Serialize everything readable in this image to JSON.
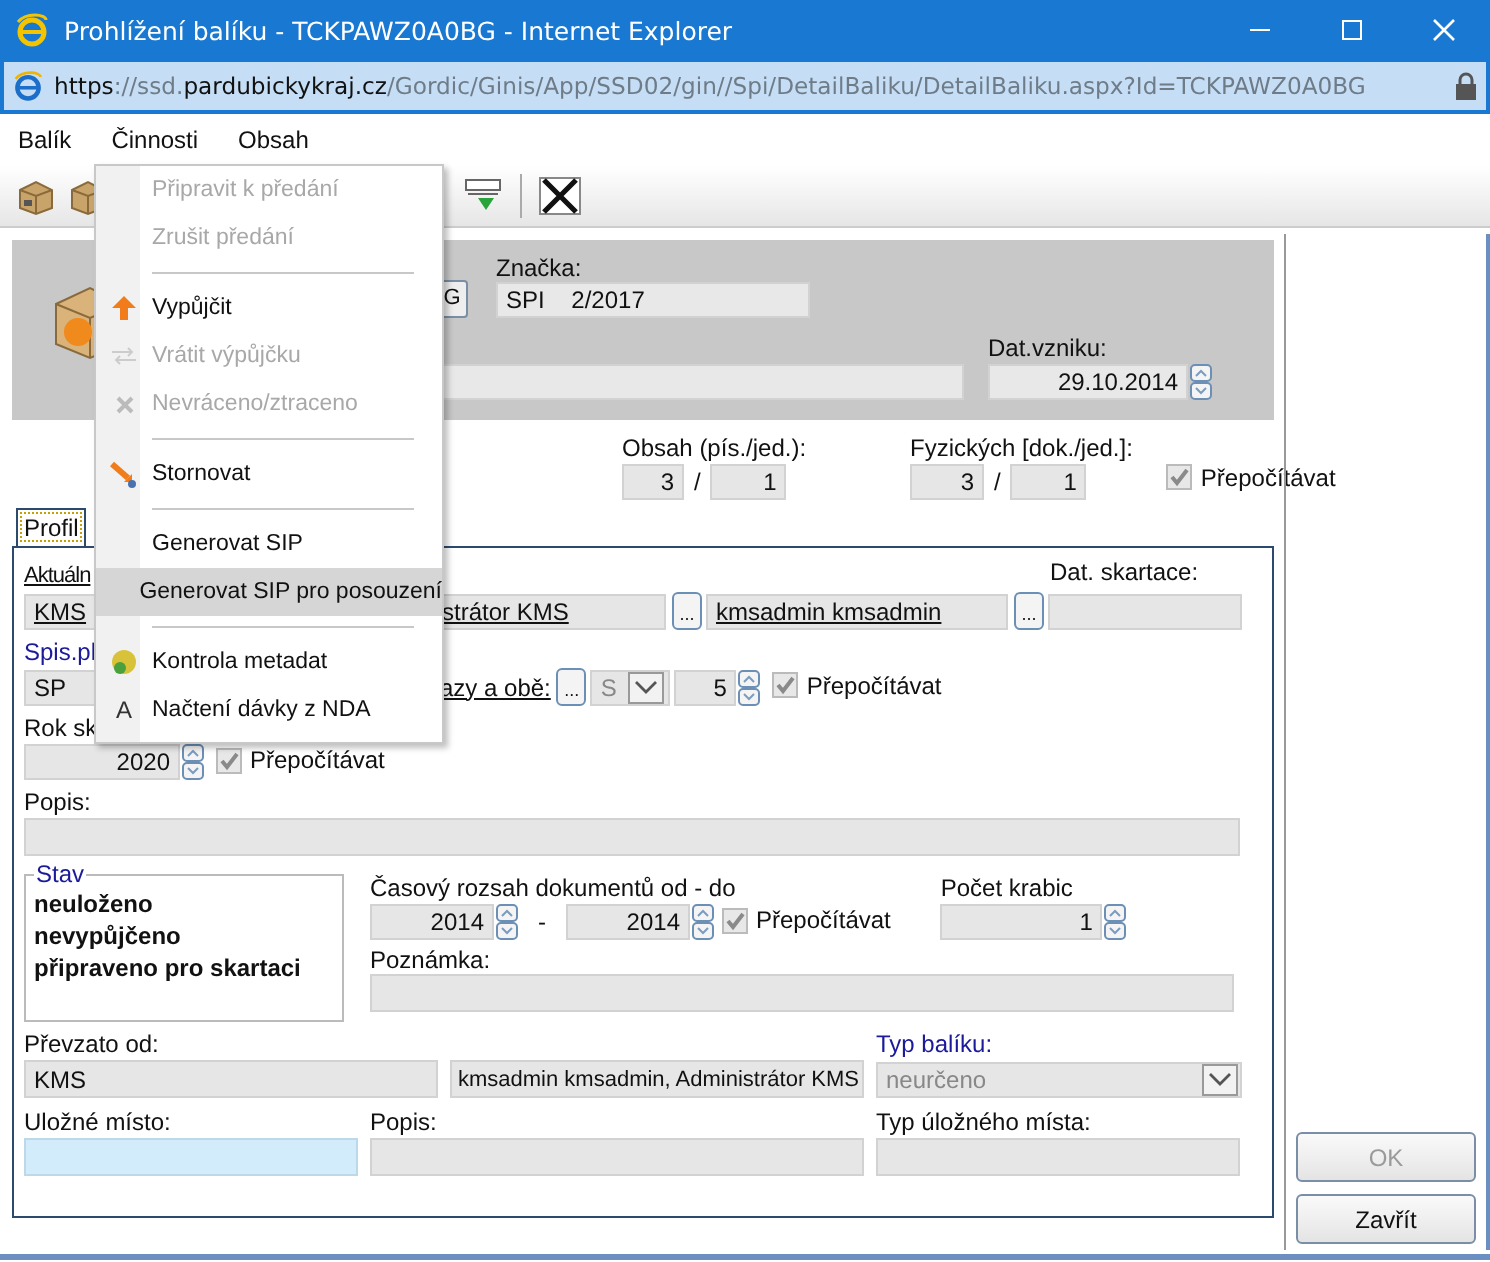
{
  "window": {
    "title": "Prohlížení balíku - TCKPAWZ0A0BG - Internet Explorer"
  },
  "address_bar": {
    "url_parts": [
      {
        "text": "https",
        "strong": true
      },
      {
        "text": "://ssd.",
        "strong": false
      },
      {
        "text": "pardubickykraj.cz",
        "strong": true
      },
      {
        "text": "/Gordic/Ginis/App/SSD02/gin//Spi/DetailBaliku/DetailBaliku.aspx?Id=TCKPAWZ0A0BG",
        "strong": false
      }
    ]
  },
  "menu_bar": [
    "Balík",
    "Činnosti",
    "Obsah"
  ],
  "dropdown": [
    {
      "kind": "item",
      "label": "Připravit k předání",
      "disabled": true,
      "selected": false
    },
    {
      "kind": "item",
      "label": "Zrušit předání",
      "disabled": true,
      "selected": false
    },
    {
      "kind": "separator"
    },
    {
      "kind": "item",
      "label": "Vypůjčit",
      "disabled": false,
      "selected": false
    },
    {
      "kind": "item",
      "label": "Vrátit výpůjčku",
      "disabled": true,
      "selected": false
    },
    {
      "kind": "item",
      "label": "Nevráceno/ztraceno",
      "disabled": true,
      "selected": false
    },
    {
      "kind": "separator"
    },
    {
      "kind": "item",
      "label": "Stornovat",
      "disabled": false,
      "selected": false
    },
    {
      "kind": "separator"
    },
    {
      "kind": "item",
      "label": "Generovat SIP",
      "disabled": false,
      "selected": false
    },
    {
      "kind": "item",
      "label": "Generovat SIP pro posouzení",
      "disabled": false,
      "selected": true
    },
    {
      "kind": "separator"
    },
    {
      "kind": "item",
      "label": "Kontrola metadat",
      "disabled": false,
      "selected": false
    },
    {
      "kind": "item",
      "label": "Načtení dávky z NDA",
      "glyph": "A",
      "disabled": false,
      "selected": false
    }
  ],
  "header": {
    "g_button": "G",
    "znacka": {
      "label": "Značka:",
      "value": "SPI    2/2017"
    },
    "dat_vzniku": {
      "label": "Dat.vzniku:",
      "value": "29.10.2014"
    }
  },
  "counts": {
    "obsah": {
      "label": "Obsah (pís./jed.):",
      "a": "3",
      "sep": "/",
      "b": "1"
    },
    "fyzickych": {
      "label": "Fyzických [dok./jed.]:",
      "a": "3",
      "sep": "/",
      "b": "1"
    },
    "recalc": {
      "label": "Přepočítávat",
      "checked": true
    }
  },
  "tabs": [
    {
      "label": "Profil",
      "selected": true
    }
  ],
  "profile": {
    "aktualni_label": "Aktuáln",
    "owner_code": "KMS",
    "owner_name": "strátor KMS",
    "browse_1": "...",
    "owner_user": "kmsadmin kmsadmin",
    "browse_2": "...",
    "dat_skartace_label": "Dat. skartace:",
    "spis_label": "Spis.pl",
    "spis_value": "SP",
    "znak_link": "azy a obě:",
    "browse_3": "...",
    "znak_select": "S",
    "lhuta": "5",
    "recalc": {
      "label": "Přepočítávat",
      "checked": true
    },
    "rok_label": "Rok sk",
    "rok_value": "2020",
    "rok_recalc": {
      "label": "Přepočítávat",
      "checked": true
    },
    "popis_label": "Popis:",
    "stav": {
      "legend": "Stav",
      "items": [
        "neuloženo",
        "nevypůjčeno",
        "připraveno pro skartaci"
      ]
    },
    "range": {
      "label": "Časový rozsah dokumentů od - do",
      "from": "2014",
      "dash": "-",
      "to": "2014",
      "recalc": {
        "label": "Přepočítávat",
        "checked": true
      }
    },
    "krabice": {
      "label": "Počet krabic",
      "value": "1"
    },
    "poznamka_label": "Poznámka:",
    "prevzato": {
      "label": "Převzato od:",
      "code": "KMS",
      "name": "kmsadmin kmsadmin, Administrátor KMS"
    },
    "typ_baliku": {
      "label": "Typ balíku:",
      "value": "neurčeno"
    },
    "ulozne_label": "Uložné místo:",
    "popis2_label": "Popis:",
    "typ_mista_label": "Typ úložného místa:"
  },
  "buttons": [
    {
      "label": "OK",
      "disabled": true
    },
    {
      "label": "Zavřít",
      "disabled": false
    }
  ]
}
